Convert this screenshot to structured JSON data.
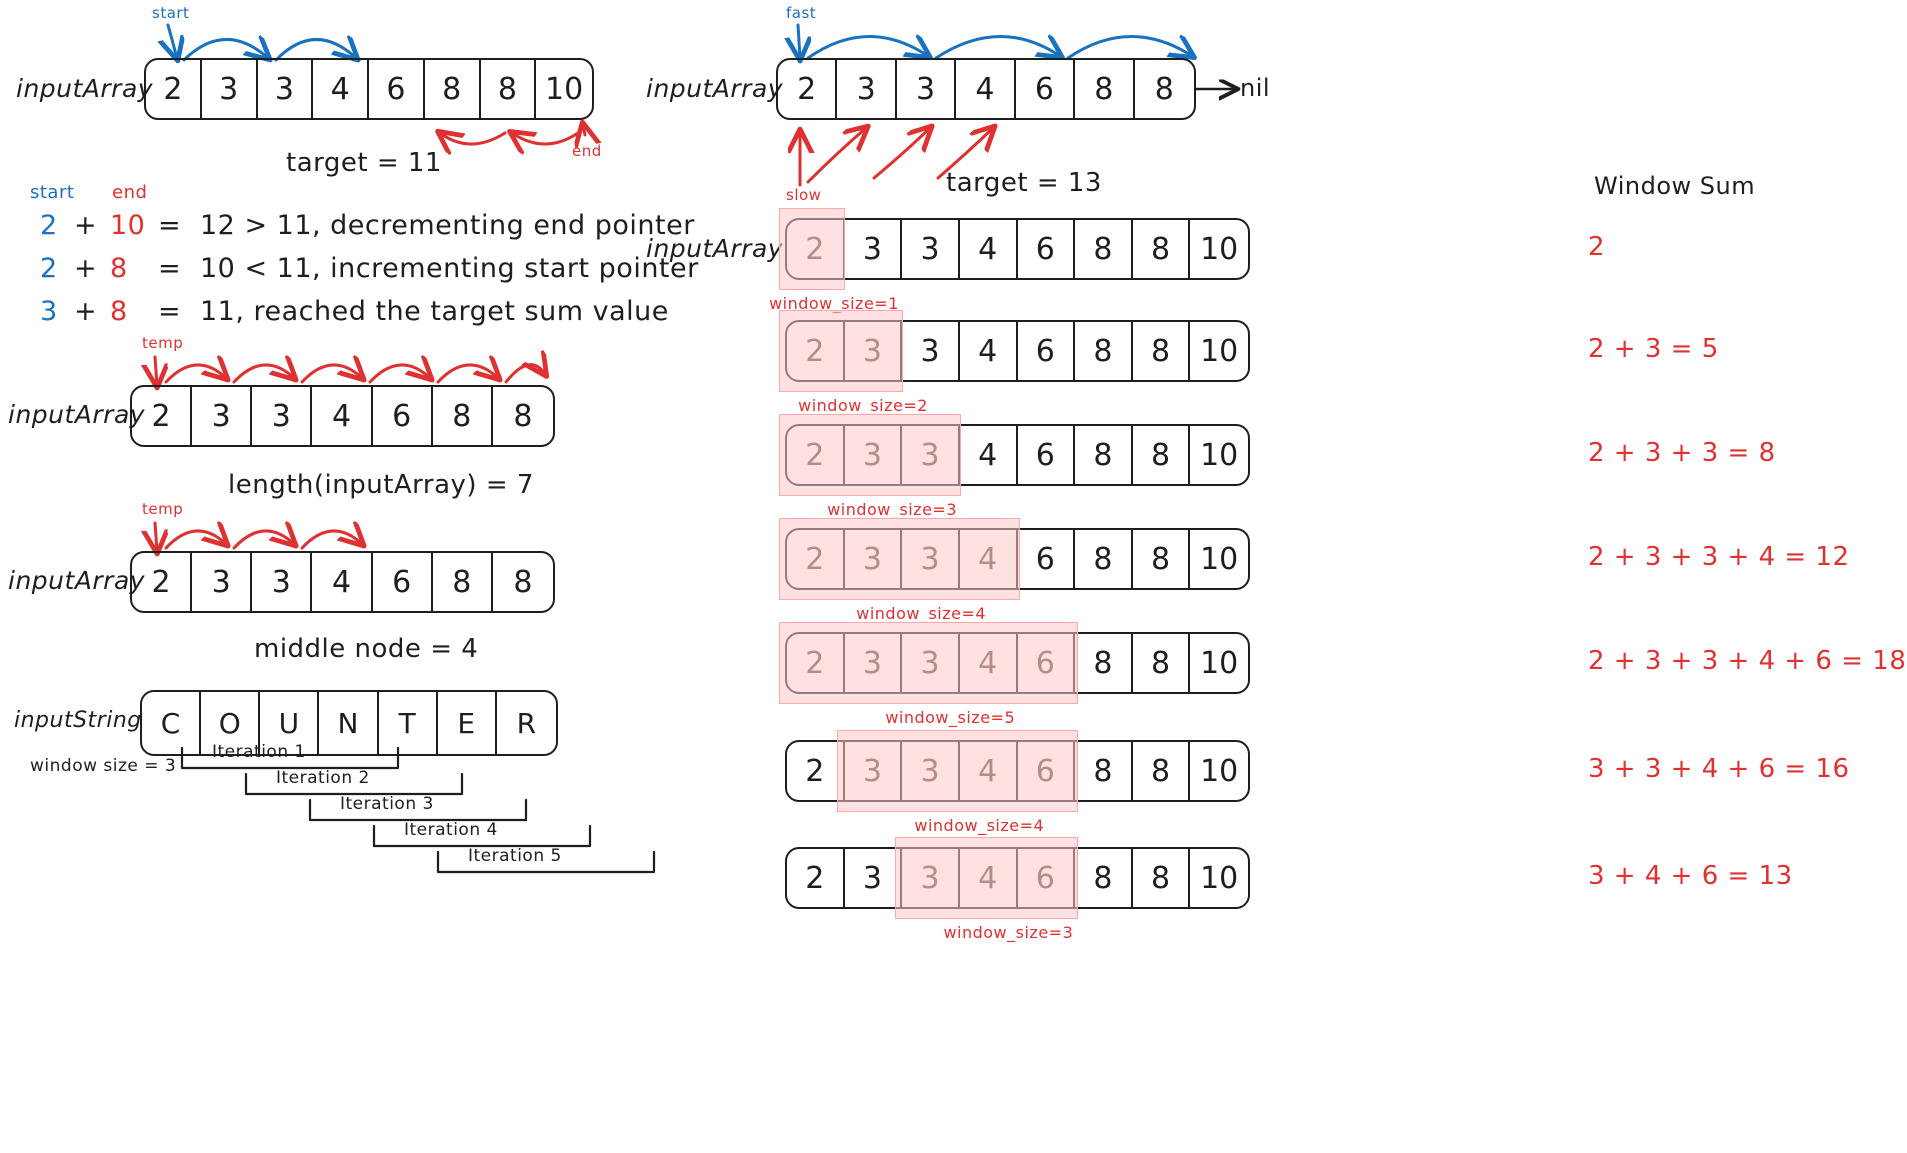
{
  "colors": {
    "ink": "#1e1e1e",
    "blue": "#1971c2",
    "red": "#e03131",
    "highlight_fill": "#ffc9c9",
    "highlight_stroke": "#ffa8a8"
  },
  "two_pointer": {
    "array_label": "inputArray",
    "cells": [
      "2",
      "3",
      "3",
      "4",
      "6",
      "8",
      "8",
      "10"
    ],
    "start_label": "start",
    "end_label": "end",
    "target_caption": "target = 11",
    "legend": {
      "start": "start",
      "end": "end"
    },
    "steps": [
      {
        "a": "2",
        "plus": "+",
        "b": "10",
        "eq": "=",
        "text": "12 > 11, decrementing end pointer"
      },
      {
        "a": "2",
        "plus": "+",
        "b": "8",
        "eq": "=",
        "text": "10 < 11, incrementing start pointer"
      },
      {
        "a": "3",
        "plus": "+",
        "b": "8",
        "eq": "=",
        "text": "11, reached the target sum value"
      }
    ]
  },
  "length_demo": {
    "array_label": "inputArray",
    "cells": [
      "2",
      "3",
      "3",
      "4",
      "6",
      "8",
      "8"
    ],
    "temp_label": "temp",
    "caption": "length(inputArray) = 7"
  },
  "middle_demo": {
    "array_label": "inputArray",
    "cells": [
      "2",
      "3",
      "3",
      "4",
      "6",
      "8",
      "8"
    ],
    "temp_label": "temp",
    "caption": "middle node = 4"
  },
  "string_demo": {
    "string_label": "inputString",
    "cells": [
      "C",
      "O",
      "U",
      "N",
      "T",
      "E",
      "R"
    ],
    "window_size_label": "window size = 3",
    "iterations": [
      {
        "label": "Iteration 1",
        "start_index": 0
      },
      {
        "label": "Iteration 2",
        "start_index": 1
      },
      {
        "label": "Iteration 3",
        "start_index": 2
      },
      {
        "label": "Iteration 4",
        "start_index": 3
      },
      {
        "label": "Iteration 5",
        "start_index": 4
      }
    ]
  },
  "fast_slow": {
    "array_label": "inputArray",
    "cells": [
      "2",
      "3",
      "3",
      "4",
      "6",
      "8",
      "8"
    ],
    "fast_label": "fast",
    "slow_label": "slow",
    "nil_label": "nil",
    "target_caption": "target = 13"
  },
  "sliding_window": {
    "array_label": "inputArray",
    "column_header": "Window Sum",
    "rows": [
      {
        "cells": [
          "2",
          "3",
          "3",
          "4",
          "6",
          "8",
          "8",
          "10"
        ],
        "window_start": 0,
        "window_len": 1,
        "window_size_label": "window_size=1",
        "sum_text": "2",
        "show_array_label": true
      },
      {
        "cells": [
          "2",
          "3",
          "3",
          "4",
          "6",
          "8",
          "8",
          "10"
        ],
        "window_start": 0,
        "window_len": 2,
        "window_size_label": "window_size=2",
        "sum_text": "2 + 3 = 5",
        "show_array_label": false
      },
      {
        "cells": [
          "2",
          "3",
          "3",
          "4",
          "6",
          "8",
          "8",
          "10"
        ],
        "window_start": 0,
        "window_len": 3,
        "window_size_label": "window_size=3",
        "sum_text": "2 + 3 + 3 = 8",
        "show_array_label": false
      },
      {
        "cells": [
          "2",
          "3",
          "3",
          "4",
          "6",
          "8",
          "8",
          "10"
        ],
        "window_start": 0,
        "window_len": 4,
        "window_size_label": "window_size=4",
        "sum_text": "2 + 3 + 3 + 4 = 12",
        "show_array_label": false
      },
      {
        "cells": [
          "2",
          "3",
          "3",
          "4",
          "6",
          "8",
          "8",
          "10"
        ],
        "window_start": 0,
        "window_len": 5,
        "window_size_label": "window_size=5",
        "sum_text": "2 + 3 + 3 + 4 + 6 = 18",
        "show_array_label": false
      },
      {
        "cells": [
          "2",
          "3",
          "3",
          "4",
          "6",
          "8",
          "8",
          "10"
        ],
        "window_start": 1,
        "window_len": 4,
        "window_size_label": "window_size=4",
        "sum_text": "3 + 3 + 4 + 6 = 16",
        "show_array_label": false
      },
      {
        "cells": [
          "2",
          "3",
          "3",
          "4",
          "6",
          "8",
          "8",
          "10"
        ],
        "window_start": 2,
        "window_len": 3,
        "window_size_label": "window_size=3",
        "sum_text": "3 + 4 + 6 = 13",
        "show_array_label": false
      }
    ]
  }
}
